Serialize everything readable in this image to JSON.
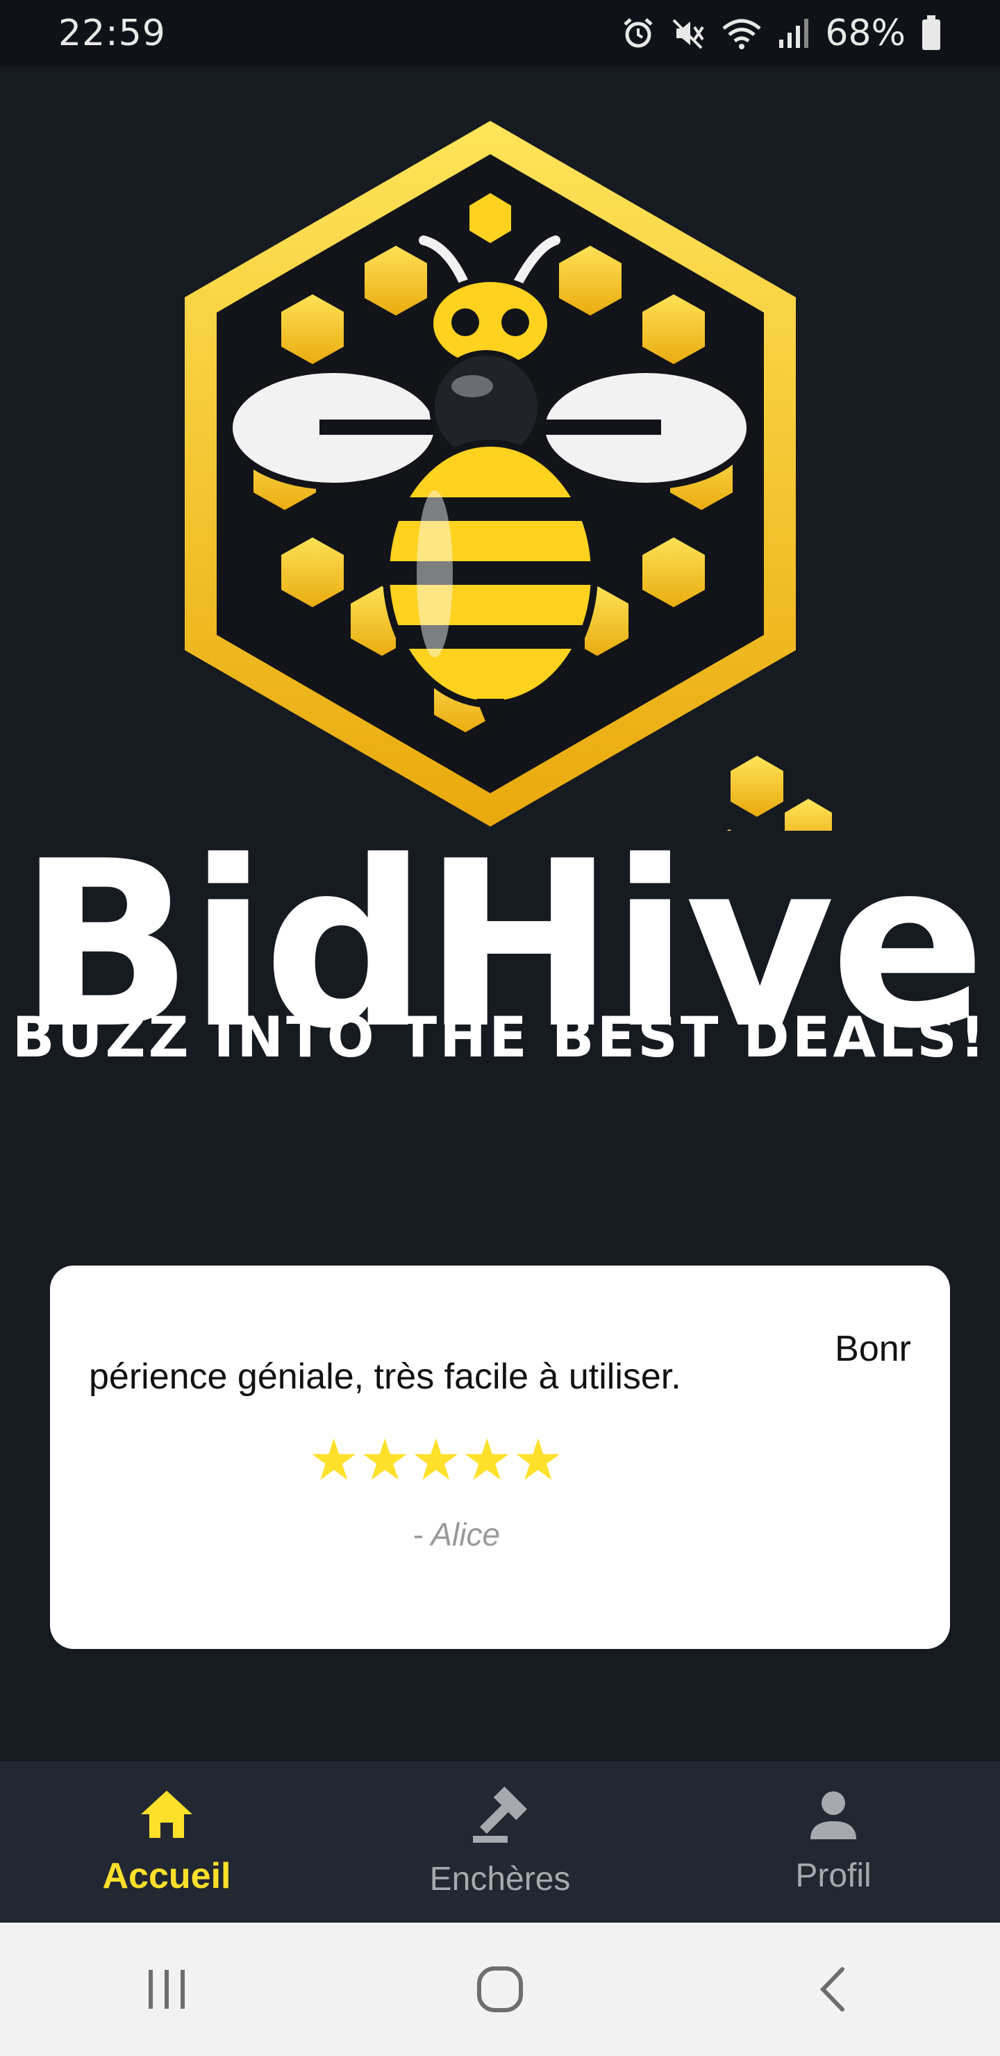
{
  "status_bar": {
    "time": "22:59",
    "battery": "68%",
    "icons": [
      "alarm-icon",
      "mute-icon",
      "wifi-icon",
      "signal-icon",
      "battery-icon"
    ]
  },
  "brand": {
    "name": "BidHive",
    "tagline": "BUZZ INTO THE BEST DEALS!",
    "colors": {
      "gold": "#ffd21f",
      "dark": "#161a21"
    }
  },
  "review": {
    "text": "périence géniale, très facile à utiliser.",
    "text_overflow": "Bonr",
    "stars": "★★★★★",
    "rating": 5,
    "author": "- Alice"
  },
  "bottom_nav": {
    "items": [
      {
        "label": "Accueil",
        "icon": "home-icon",
        "active": true
      },
      {
        "label": "Enchères",
        "icon": "gavel-icon",
        "active": false
      },
      {
        "label": "Profil",
        "icon": "person-icon",
        "active": false
      }
    ],
    "active_color": "#ffe02a",
    "inactive_color": "#a6a9ae"
  },
  "system_nav": [
    "recents-icon",
    "home-circle-icon",
    "back-icon"
  ]
}
